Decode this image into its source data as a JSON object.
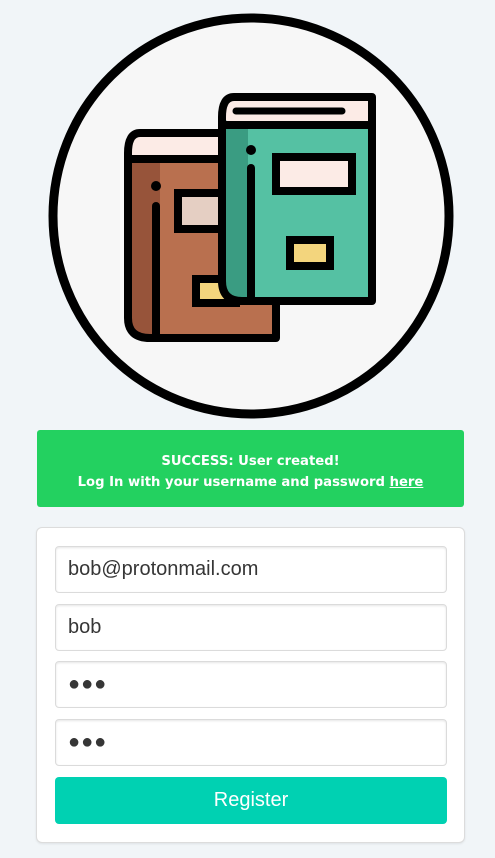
{
  "logo": {
    "icon": "books-icon",
    "colors": {
      "circle_fill": "#f7f7f7",
      "outline": "#000000",
      "brown_book": "#b9704f",
      "brown_spine": "#97543a",
      "green_book": "#55c1a3",
      "green_spine": "#3a9c82",
      "pages": "#fcebe6",
      "brown_label": "#e5cfc3",
      "yellow_tag": "#f3d57d"
    }
  },
  "alert": {
    "line1": "SUCCESS: User created!",
    "line2_prefix": "Log In with your username and password",
    "line2_link": "here",
    "color": "#23d160"
  },
  "form": {
    "email_value": "bob@protonmail.com",
    "username_value": "bob",
    "password_value": "●●●",
    "confirm_value": "●●●",
    "submit_label": "Register",
    "submit_color": "#00d1b2"
  }
}
